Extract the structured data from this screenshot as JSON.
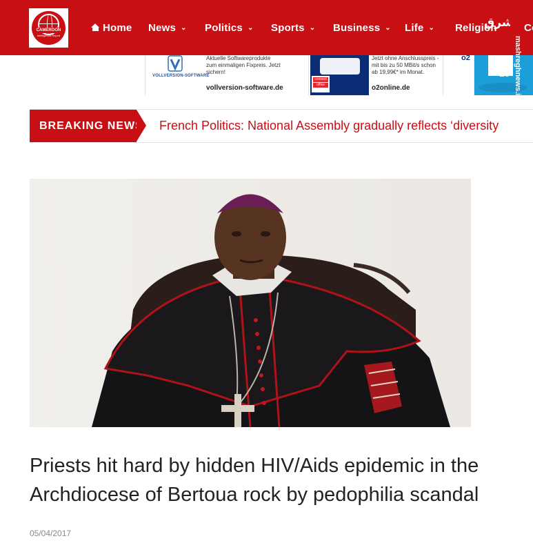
{
  "site": {
    "logo_line1": "CAMEROON",
    "logo_line2": "Intelligence Report"
  },
  "nav": {
    "items": [
      {
        "label": "Home",
        "has_dropdown": false,
        "icon": "home-icon"
      },
      {
        "label": "News",
        "has_dropdown": true
      },
      {
        "label": "Politics",
        "has_dropdown": true
      },
      {
        "label": "Sports",
        "has_dropdown": true
      },
      {
        "label": "Business",
        "has_dropdown": true
      },
      {
        "label": "Life",
        "has_dropdown": true
      },
      {
        "label": "Religion",
        "has_dropdown": false
      },
      {
        "label": "Co",
        "has_dropdown": false
      }
    ],
    "bar_color": "#c70f14"
  },
  "watermark": {
    "nav_mark": "مشرق",
    "side_text": "mashreghnews.ir"
  },
  "ads": {
    "ad1": {
      "brand": "VOLLVERSION-SOFTWARE",
      "tagline": "Aktuelle Softwareprodukte zum einmaligen Fixpreis. Jetzt sichern!",
      "domain": "vollversion-software.de"
    },
    "ad2": {
      "tag_top": "connect",
      "tag_mid": "office",
      "tagline": "Jetzt ohne Anschlusspreis - mit bis zu 50 MBit/s schon ab 19,99€* im Monat.",
      "domain": "o2online.de"
    },
    "ad3": {
      "mark": "o2"
    },
    "ad4": {
      "number": "10"
    }
  },
  "breaking": {
    "label": "BREAKING NEWS",
    "headline": "French Politics: National Assembly gradually reflects ‘diversity"
  },
  "article": {
    "title": "Priests hit hard by hidden HIV/Aids epidemic in the Archdiocese of Bertoua rock by pedophilia scandal",
    "date": "05/04/2017"
  }
}
